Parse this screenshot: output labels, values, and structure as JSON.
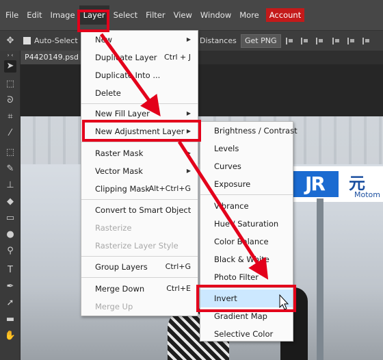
{
  "menubar": {
    "items": [
      "File",
      "Edit",
      "Image",
      "Layer",
      "Select",
      "Filter",
      "View",
      "Window",
      "More"
    ],
    "account": "Account"
  },
  "options": {
    "auto_select": "Auto-Select",
    "distances": "Distances",
    "get_png": "Get PNG"
  },
  "document_tab": "P4420149.psd *",
  "photo": {
    "sign_logo": "JR",
    "sign_text": "元",
    "sign_sub": "Motom"
  },
  "layer_menu": {
    "items": [
      {
        "label": "New",
        "submenu": true
      },
      {
        "label": "Duplicate Layer",
        "shortcut": "Ctrl + J"
      },
      {
        "label": "Duplicate Into ..."
      },
      {
        "label": "Delete"
      },
      {
        "label": "New Fill Layer",
        "submenu": true
      },
      {
        "label": "New Adjustment Layer",
        "submenu": true
      },
      {
        "label": "Raster Mask",
        "submenu": true
      },
      {
        "label": "Vector Mask",
        "submenu": true
      },
      {
        "label": "Clipping Mask",
        "shortcut": "Alt+Ctrl+G"
      },
      {
        "label": "Convert to Smart Object"
      },
      {
        "label": "Rasterize",
        "disabled": true
      },
      {
        "label": "Rasterize Layer Style",
        "disabled": true
      },
      {
        "label": "Group Layers",
        "shortcut": "Ctrl+G"
      },
      {
        "label": "Merge Down",
        "shortcut": "Ctrl+E"
      },
      {
        "label": "Merge Up",
        "disabled": true
      }
    ]
  },
  "adjustment_menu": {
    "items": [
      "Brightness / Contrast",
      "Levels",
      "Curves",
      "Exposure",
      "Vibrance",
      "Hue / Saturation",
      "Color Balance",
      "Black & White",
      "Photo Filter",
      "Invert",
      "Gradient Map",
      "Selective Color"
    ],
    "highlighted": "Invert"
  },
  "colors": {
    "menubar_bg": "#474747",
    "account_bg": "#c41a1a",
    "annotation_red": "#e3001b",
    "highlight": "#cce8ff"
  }
}
